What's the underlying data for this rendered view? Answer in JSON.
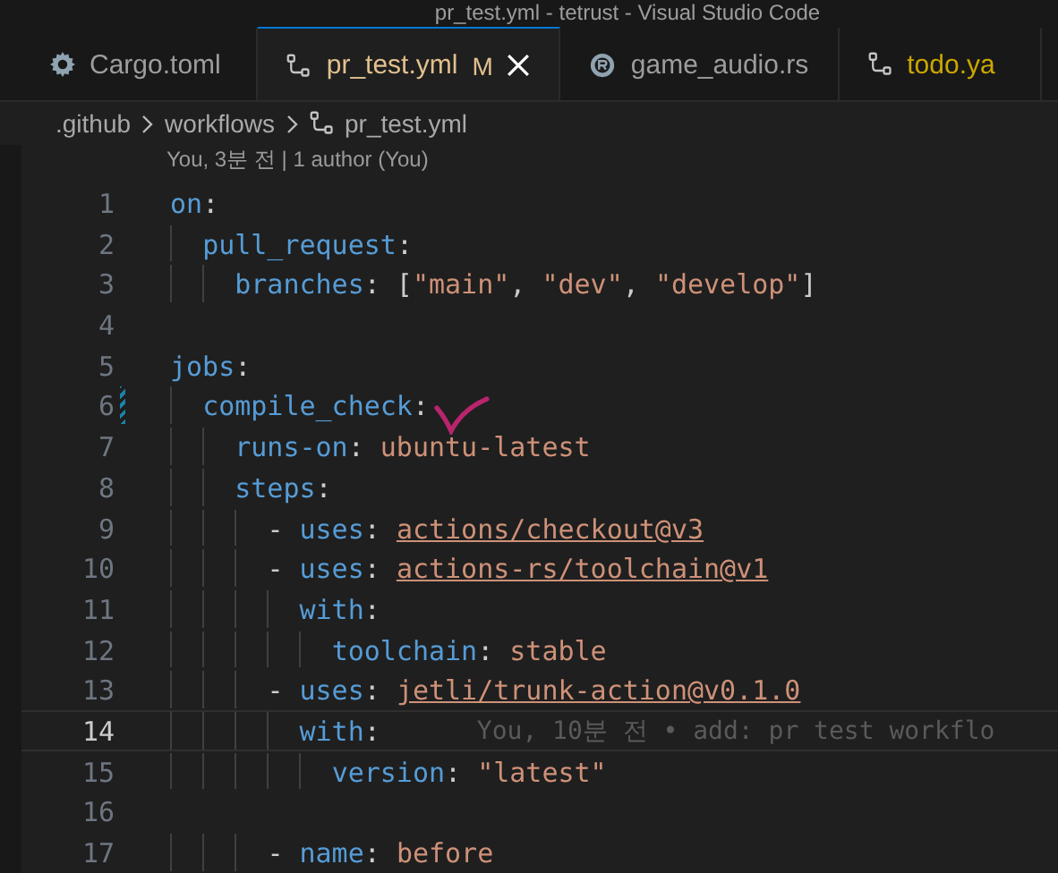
{
  "window": {
    "title": "pr_test.yml - tetrust - Visual Studio Code"
  },
  "tabs": [
    {
      "label": "Cargo.toml",
      "kind": "toml",
      "selected": false,
      "color": "#9d9d9d"
    },
    {
      "label": "pr_test.yml",
      "kind": "yaml",
      "selected": true,
      "color": "#e2c08d",
      "badge": "M"
    },
    {
      "label": "game_audio.rs",
      "kind": "rust",
      "selected": false,
      "color": "#9d9d9d"
    },
    {
      "label": "todo.ya",
      "kind": "yaml",
      "selected": false,
      "color": "#cca700"
    }
  ],
  "breadcrumb": [
    {
      "label": ".github",
      "kind": "folder"
    },
    {
      "label": "workflows",
      "kind": "folder"
    },
    {
      "label": "pr_test.yml",
      "kind": "yaml"
    }
  ],
  "codelens": "You, 3분 전 | 1 author (You)",
  "lines": [
    {
      "number": "1",
      "current": false,
      "modified": false,
      "tokens": [
        {
          "kind": "key",
          "text": "on"
        },
        {
          "kind": "punct",
          "text": ":"
        }
      ]
    },
    {
      "number": "2",
      "current": false,
      "modified": false,
      "tokens": [
        {
          "kind": "key",
          "text": "  pull_request"
        },
        {
          "kind": "punct",
          "text": ":"
        }
      ]
    },
    {
      "number": "3",
      "current": false,
      "modified": false,
      "tokens": [
        {
          "kind": "key",
          "text": "    branches"
        },
        {
          "kind": "punct",
          "text": ": ["
        },
        {
          "kind": "string",
          "text": "\"main\""
        },
        {
          "kind": "punct",
          "text": ", "
        },
        {
          "kind": "string",
          "text": "\"dev\""
        },
        {
          "kind": "punct",
          "text": ", "
        },
        {
          "kind": "string",
          "text": "\"develop\""
        },
        {
          "kind": "punct",
          "text": "]"
        }
      ]
    },
    {
      "number": "4",
      "current": false,
      "modified": false
    },
    {
      "number": "5",
      "current": false,
      "modified": false,
      "tokens": [
        {
          "kind": "key",
          "text": "jobs"
        },
        {
          "kind": "punct",
          "text": ":"
        }
      ]
    },
    {
      "number": "6",
      "current": false,
      "modified": true,
      "tokens": [
        {
          "kind": "key",
          "text": "  compile_check"
        },
        {
          "kind": "punct",
          "text": ":"
        }
      ]
    },
    {
      "number": "7",
      "current": false,
      "modified": false,
      "tokens": [
        {
          "kind": "key",
          "text": "    runs-on"
        },
        {
          "kind": "punct",
          "text": ": "
        },
        {
          "kind": "string",
          "text": "ubuntu-latest"
        }
      ]
    },
    {
      "number": "8",
      "current": false,
      "modified": false,
      "tokens": [
        {
          "kind": "key",
          "text": "    steps"
        },
        {
          "kind": "punct",
          "text": ":"
        }
      ]
    },
    {
      "number": "9",
      "current": false,
      "modified": false,
      "tokens": [
        {
          "kind": "punct",
          "text": "      - "
        },
        {
          "kind": "key",
          "text": "uses"
        },
        {
          "kind": "punct",
          "text": ": "
        },
        {
          "kind": "link",
          "text": "actions/checkout@v3"
        }
      ]
    },
    {
      "number": "10",
      "current": false,
      "modified": false,
      "tokens": [
        {
          "kind": "punct",
          "text": "      - "
        },
        {
          "kind": "key",
          "text": "uses"
        },
        {
          "kind": "punct",
          "text": ": "
        },
        {
          "kind": "link",
          "text": "actions-rs/toolchain@v1"
        }
      ]
    },
    {
      "number": "11",
      "current": false,
      "modified": false,
      "tokens": [
        {
          "kind": "key",
          "text": "        with"
        },
        {
          "kind": "punct",
          "text": ":"
        }
      ]
    },
    {
      "number": "12",
      "current": false,
      "modified": false,
      "tokens": [
        {
          "kind": "key",
          "text": "          toolchain"
        },
        {
          "kind": "punct",
          "text": ": "
        },
        {
          "kind": "string",
          "text": "stable"
        }
      ]
    },
    {
      "number": "13",
      "current": false,
      "modified": false,
      "tokens": [
        {
          "kind": "punct",
          "text": "      - "
        },
        {
          "kind": "key",
          "text": "uses"
        },
        {
          "kind": "punct",
          "text": ": "
        },
        {
          "kind": "link",
          "text": "jetli/trunk-action@v0.1.0"
        }
      ]
    },
    {
      "number": "14",
      "current": true,
      "modified": false,
      "blame": "You, 10분 전 • add: pr test workflo",
      "tokens": [
        {
          "kind": "key",
          "text": "        with"
        },
        {
          "kind": "punct",
          "text": ":"
        }
      ]
    },
    {
      "number": "15",
      "current": false,
      "modified": false,
      "tokens": [
        {
          "kind": "key",
          "text": "          version"
        },
        {
          "kind": "punct",
          "text": ": "
        },
        {
          "kind": "string",
          "text": "\"latest\""
        }
      ]
    },
    {
      "number": "16",
      "current": false,
      "modified": false
    },
    {
      "number": "17",
      "current": false,
      "modified": false,
      "tokens": [
        {
          "kind": "punct",
          "text": "      - "
        },
        {
          "kind": "key",
          "text": "name"
        },
        {
          "kind": "punct",
          "text": ": "
        },
        {
          "kind": "string",
          "text": "before"
        }
      ]
    }
  ]
}
